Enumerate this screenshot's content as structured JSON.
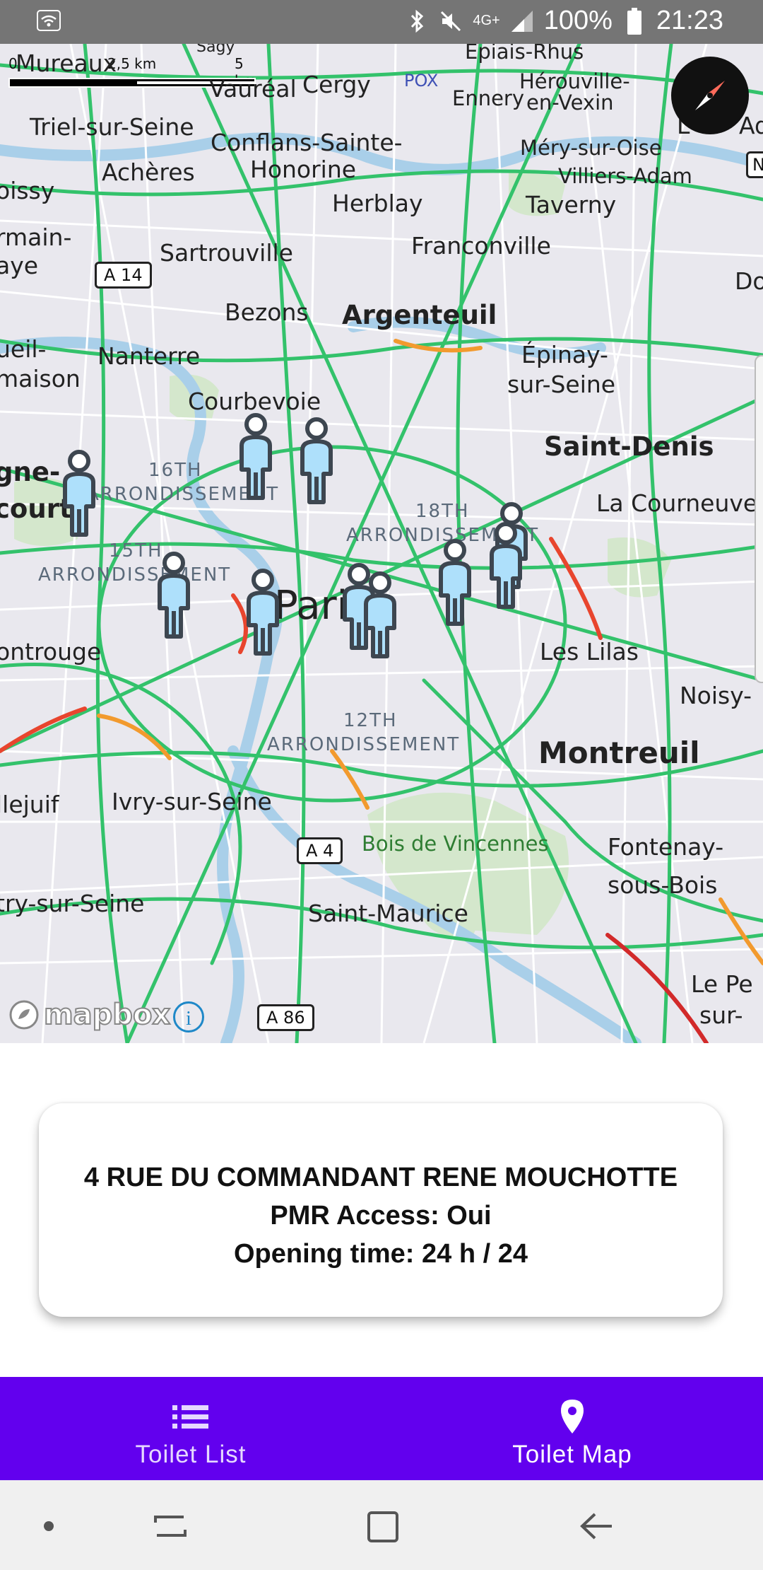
{
  "status_bar": {
    "battery": "100%",
    "time": "21:23",
    "network": "4G+",
    "icons": [
      "wifi-icon",
      "bluetooth-icon",
      "mute-icon",
      "signal-icon",
      "battery-icon"
    ]
  },
  "map": {
    "scale_labels": [
      "0",
      "2,5 km",
      "5 km"
    ],
    "places": [
      "Mureaux",
      "Vauréal",
      "Cergy",
      "Épiais-Rhus",
      "POX",
      "Hérouville-",
      "en-Vexin",
      "Ennery",
      "Triel-sur-Seine",
      "Conflans-Sainte-",
      "Honorine",
      "Méry-sur-Oise",
      "Villiers-Adam",
      "oissy",
      "Achères",
      "Herblay",
      "Taverny",
      "rmain-",
      "aye",
      "Sartrouville",
      "Franconville",
      "Do",
      "Bezons",
      "Argenteuil",
      "ueil-",
      "maison",
      "Nanterre",
      "Épinay-",
      "sur-Seine",
      "Courbevoie",
      "Saint-Denis",
      "gne-",
      "court",
      "La Courneuve",
      "Pari",
      "ontrouge",
      "Les Lilas",
      "Noisy-",
      "Montreuil",
      "llejuif",
      "Ivry-sur-Seine",
      "Bois de Vincennes",
      "Fontenay-",
      "sous-Bois",
      "try-sur-Seine",
      "Saint-Maurice",
      "Le Pe",
      "sur-",
      "Sagy",
      "Ad",
      "L",
      "N"
    ],
    "arrondissements": [
      "16TH",
      "ARRONDISSEMENT",
      "15TH",
      "ARRONDISSEMENT",
      "18TH",
      "ARRONDISSEMENT",
      "12TH",
      "ARRONDISSEMENT"
    ],
    "roads": [
      "A 14",
      "A 4",
      "A 86"
    ],
    "attribution": "mapbox",
    "toilet_marker_count": 11
  },
  "card": {
    "address": "4  RUE DU COMMANDANT RENE MOUCHOTTE",
    "pmr_access": "PMR Access: Oui",
    "opening_time": "Opening time: 24 h / 24"
  },
  "bottom_nav": {
    "items": [
      {
        "label": "Toilet List",
        "icon": "list-icon",
        "active": false
      },
      {
        "label": "Toilet Map",
        "icon": "map-pin-icon",
        "active": true
      }
    ]
  },
  "colors": {
    "accent": "#6200ee",
    "marker_fill": "#aee0fb",
    "marker_stroke": "#3d4650",
    "road_green": "#33c26b"
  }
}
